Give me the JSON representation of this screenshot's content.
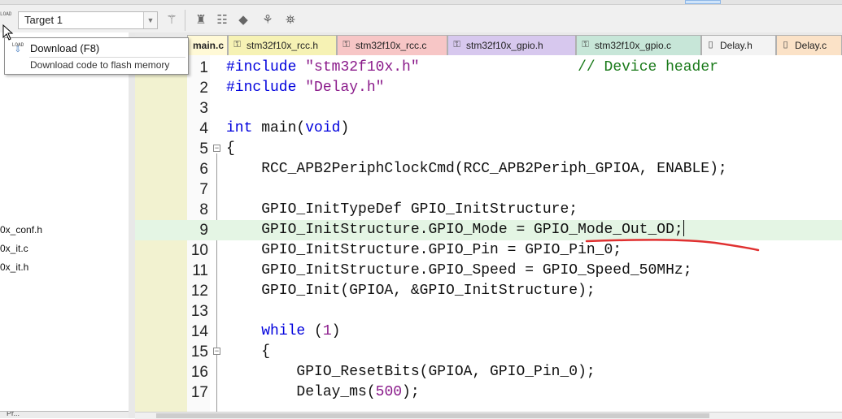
{
  "toolbar": {
    "load_label": "LOAD",
    "target_value": "Target 1",
    "icons": [
      "magic-wand-icon",
      "pack-installer-icon",
      "manage-components-icon",
      "component-diamond-icon",
      "pack-select-icon",
      "runtime-env-icon"
    ]
  },
  "tooltip": {
    "title": "Download (F8)",
    "description": "Download code to flash memory",
    "icon_label": "LOAD"
  },
  "left_panel": {
    "files": [
      "0x_conf.h",
      "0x_it.c",
      "0x_it.h"
    ],
    "bottom_tabs": [
      "Pr..."
    ]
  },
  "tabs": [
    {
      "label": "main.c",
      "active": true
    },
    {
      "label": "stm32f10x_rcc.h",
      "color": "#f6f2b4"
    },
    {
      "label": "stm32f10x_rcc.c",
      "color": "#f7c6c6"
    },
    {
      "label": "stm32f10x_gpio.h",
      "color": "#d7c8ee"
    },
    {
      "label": "stm32f10x_gpio.c",
      "color": "#c7e6d8"
    },
    {
      "label": "Delay.h",
      "color": "#f3f3f3"
    },
    {
      "label": "Delay.c",
      "color": "#fbe2c7"
    }
  ],
  "code": {
    "highlight_line": 9,
    "lines": [
      {
        "n": "1",
        "text": "#include \"stm32f10x.h\"                  // Device header"
      },
      {
        "n": "2",
        "text": "#include \"Delay.h\""
      },
      {
        "n": "3",
        "text": ""
      },
      {
        "n": "4",
        "text": "int main(void)"
      },
      {
        "n": "5",
        "text": "{"
      },
      {
        "n": "6",
        "text": "    RCC_APB2PeriphClockCmd(RCC_APB2Periph_GPIOA, ENABLE);"
      },
      {
        "n": "7",
        "text": ""
      },
      {
        "n": "8",
        "text": "    GPIO_InitTypeDef GPIO_InitStructure;"
      },
      {
        "n": "9",
        "text": "    GPIO_InitStructure.GPIO_Mode = GPIO_Mode_Out_OD;"
      },
      {
        "n": "10",
        "text": "    GPIO_InitStructure.GPIO_Pin = GPIO_Pin_0;"
      },
      {
        "n": "11",
        "text": "    GPIO_InitStructure.GPIO_Speed = GPIO_Speed_50MHz;"
      },
      {
        "n": "12",
        "text": "    GPIO_Init(GPIOA, &GPIO_InitStructure);"
      },
      {
        "n": "13",
        "text": ""
      },
      {
        "n": "14",
        "text": "    while (1)"
      },
      {
        "n": "15",
        "text": "    {"
      },
      {
        "n": "16",
        "text": "        GPIO_ResetBits(GPIOA, GPIO_Pin_0);"
      },
      {
        "n": "17",
        "text": "        Delay_ms(500);"
      }
    ]
  },
  "colors": {
    "accent_highlight": "#e4f5e4",
    "keyword": "#0000dd",
    "string": "#8a1a8a",
    "comment": "#1a7a1a",
    "annotation_underline": "#e03030"
  }
}
